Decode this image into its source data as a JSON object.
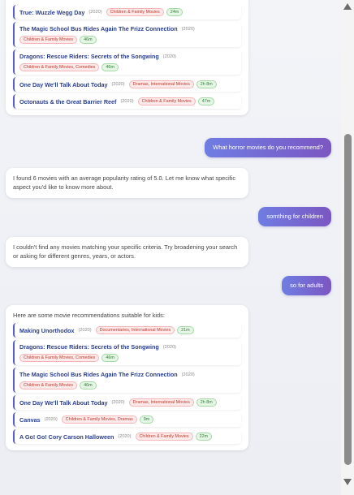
{
  "messages": {
    "bot1": {
      "movies": [
        {
          "title": "True: Wuzzle Wegg Day",
          "year": "(2020)",
          "genres": "Children & Family Movies",
          "duration": "24m"
        },
        {
          "title": "The Magic School Bus Rides Again The Frizz Connection",
          "year": "(2020)",
          "genres": "Children & Family Movies",
          "duration": "46m"
        },
        {
          "title": "Dragons: Rescue Riders: Secrets of the Songwing",
          "year": "(2020)",
          "genres": "Children & Family Movies, Comedies",
          "duration": "46m"
        },
        {
          "title": "One Day We'll Talk About Today",
          "year": "(2020)",
          "genres": "Dramas, International Movies",
          "duration": "2h 8m"
        },
        {
          "title": "Octonauts & the Great Barrier Reef",
          "year": "(2020)",
          "genres": "Children & Family Movies",
          "duration": "47m"
        }
      ]
    },
    "user1": "What horror movies do you recommend?",
    "bot2": "I found 6 movies with an average popularity rating of 5.0. Let me know what specific aspect you'd like to know more about.",
    "user2": "somthing for children",
    "bot3": "I couldn't find any movies matching your specific criteria. Try broadening your search or asking for different genres, years, or actors.",
    "user3": "so for adults",
    "bot4": {
      "intro": "Here are some movie recommendations suitable for kids:",
      "movies": [
        {
          "title": "Making Unorthodox",
          "year": "(2020)",
          "genres": "Documentaries, International Movies",
          "duration": "21m"
        },
        {
          "title": "Dragons: Rescue Riders: Secrets of the Songwing",
          "year": "(2020)",
          "genres": "Children & Family Movies, Comedies",
          "duration": "46m"
        },
        {
          "title": "The Magic School Bus Rides Again The Frizz Connection",
          "year": "(2020)",
          "genres": "Children & Family Movies",
          "duration": "46m"
        },
        {
          "title": "One Day We'll Talk About Today",
          "year": "(2020)",
          "genres": "Dramas, International Movies",
          "duration": "2h 8m"
        },
        {
          "title": "Canvas",
          "year": "(2020)",
          "genres": "Children & Family Movies, Dramas",
          "duration": "9m"
        },
        {
          "title": "A Go! Go! Cory Carson Halloween",
          "year": "(2020)",
          "genres": "Children & Family Movies",
          "duration": "22m"
        }
      ]
    }
  },
  "colors": {
    "accent_start": "#6f7de3",
    "accent_end": "#7c56c2",
    "title": "#2a3f8f",
    "genre_tag": "#c0392b",
    "duration_tag": "#2e7d32"
  },
  "icons": [
    "scroll-up-arrow-icon",
    "scroll-down-arrow-icon"
  ]
}
